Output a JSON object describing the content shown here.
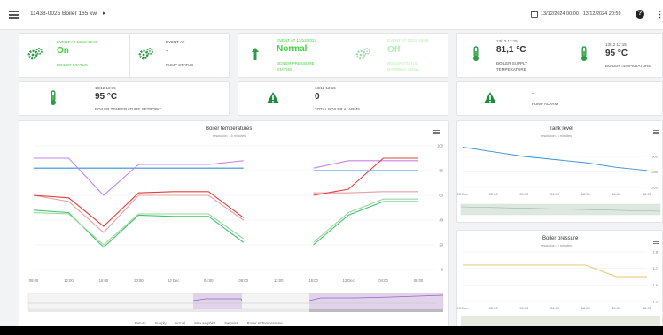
{
  "header": {
    "breadcrumb": "11438-0025 Boiler 165 kw",
    "breadcrumb_arrow": "▸",
    "date_range": "13/12/2024 00:00 - 13/12/2024 20:59"
  },
  "status_cards": [
    {
      "event": "EVENT AT 13/12 19:08",
      "value": "On",
      "label": "BOILER STATUS"
    },
    {
      "event": "EVENT AT",
      "value": "-",
      "label": "PUMP STATUS"
    },
    {
      "event": "EVENT AT 13/12/2024",
      "value": "Normal",
      "label": "BOILER PRESSURE",
      "label2": "STATUS"
    },
    {
      "event": "EVENT AT 13/12 19:08",
      "value": "Off",
      "label": "BOILER STATUS",
      "label2": "DHW/Burn Status"
    }
  ],
  "temp_cards": [
    {
      "time": "13/12 12:15",
      "value": "81,1 °C",
      "label": "BOILER SUPPLY",
      "label2": "TEMPERATURE"
    },
    {
      "time": "13/12 12:15",
      "value": "95 °C",
      "label": "BOILER TEMPERATURE"
    }
  ],
  "row2_cards": [
    {
      "time": "13/12 12:15",
      "value": "95 °C",
      "label": "BOILER TEMPERATURE SETPOINT"
    },
    {
      "time": "13/12 12:15",
      "value": "0",
      "label": "TOTAL BOILER ALARMS"
    },
    {
      "time": "",
      "value": "-",
      "label": "PUMP ALARM"
    }
  ],
  "colors": {
    "green": "#3fd23f",
    "dark_green": "#2e9e45",
    "alarm_green": "#1e8a3c",
    "series_return": "#3a8fd8",
    "series_supply": "#3ec46d",
    "series_actual": "#9bd59b",
    "series_max_setpoint": "#c783e8",
    "series_setpoint": "#e3a0a0",
    "series_boiler_temp": "#e03d3d"
  },
  "icons": [
    "gears-icon",
    "arrow-up-icon",
    "thermometer-icon",
    "alarm-triangle-icon",
    "calendar-icon",
    "help-icon",
    "kebab-icon",
    "menu-icon",
    "chart-menu-icon"
  ],
  "charts": {
    "boiler_temperatures": {
      "title": "Boiler temperatures",
      "subtitle": "resolution: 15 minutes",
      "legend": [
        "Return",
        "Supply",
        "Actual",
        "Max setpoint",
        "Setpoint",
        "Boiler In Temperature"
      ]
    },
    "tank_level": {
      "title": "Tank level",
      "subtitle": "resolution: 5 minutes"
    },
    "boiler_pressure": {
      "title": "Boiler pressure",
      "subtitle": "resolution: 5 minutes"
    }
  },
  "chart_data": [
    {
      "type": "line",
      "title": "Boiler temperatures",
      "subtitle": "resolution: 15 minutes",
      "xlabel": "",
      "ylabel": "",
      "x_ticks": [
        "08:00",
        "12:00",
        "16:00",
        "20:00",
        "12 Dec",
        "04:00",
        "08:00",
        "12:00",
        "16:00",
        "13 Dec",
        "04:00",
        "08:00"
      ],
      "y_ticks": [
        0,
        20,
        40,
        60,
        80,
        100
      ],
      "ylim": [
        0,
        100
      ],
      "x": [
        0,
        1,
        2,
        3,
        4,
        5,
        6,
        7,
        8,
        9,
        10,
        11
      ],
      "series": [
        {
          "name": "Return",
          "values": [
            82,
            82,
            82,
            82,
            82,
            82,
            82,
            null,
            80,
            80,
            80,
            80
          ]
        },
        {
          "name": "Supply",
          "values": [
            48,
            46,
            18,
            44,
            43,
            43,
            22,
            null,
            20,
            44,
            55,
            55
          ]
        },
        {
          "name": "Actual",
          "values": [
            46,
            45,
            20,
            45,
            45,
            45,
            25,
            null,
            22,
            46,
            57,
            57
          ]
        },
        {
          "name": "Max setpoint",
          "values": [
            90,
            90,
            60,
            85,
            85,
            85,
            88,
            null,
            82,
            88,
            88,
            88
          ]
        },
        {
          "name": "Setpoint",
          "values": [
            60,
            55,
            30,
            60,
            60,
            60,
            40,
            null,
            62,
            62,
            63,
            63
          ]
        },
        {
          "name": "Boiler In Temperature",
          "values": [
            60,
            58,
            35,
            62,
            63,
            63,
            42,
            null,
            60,
            65,
            90,
            90
          ]
        }
      ]
    },
    {
      "type": "line",
      "title": "Tank level",
      "subtitle": "resolution: 5 minutes",
      "x_ticks": [
        "13 Dec",
        "02:00",
        "04:00",
        "06:00",
        "08:00",
        "10:00",
        "12:00"
      ],
      "y_ticks": [
        200,
        250,
        300
      ],
      "series": [
        {
          "values": [
            330,
            315,
            300,
            290,
            280,
            265,
            255
          ]
        }
      ]
    },
    {
      "type": "line",
      "title": "Boiler pressure",
      "subtitle": "resolution: 5 minutes",
      "x_ticks": [
        "13 Dec",
        "02:00",
        "04:00",
        "06:00",
        "08:00",
        "10:00",
        "12:00"
      ],
      "y_ticks": [
        1.5,
        1.6,
        1.7,
        1.8
      ],
      "series": [
        {
          "values": [
            1.72,
            1.72,
            1.72,
            1.72,
            1.72,
            1.65,
            1.65
          ]
        }
      ]
    }
  ]
}
